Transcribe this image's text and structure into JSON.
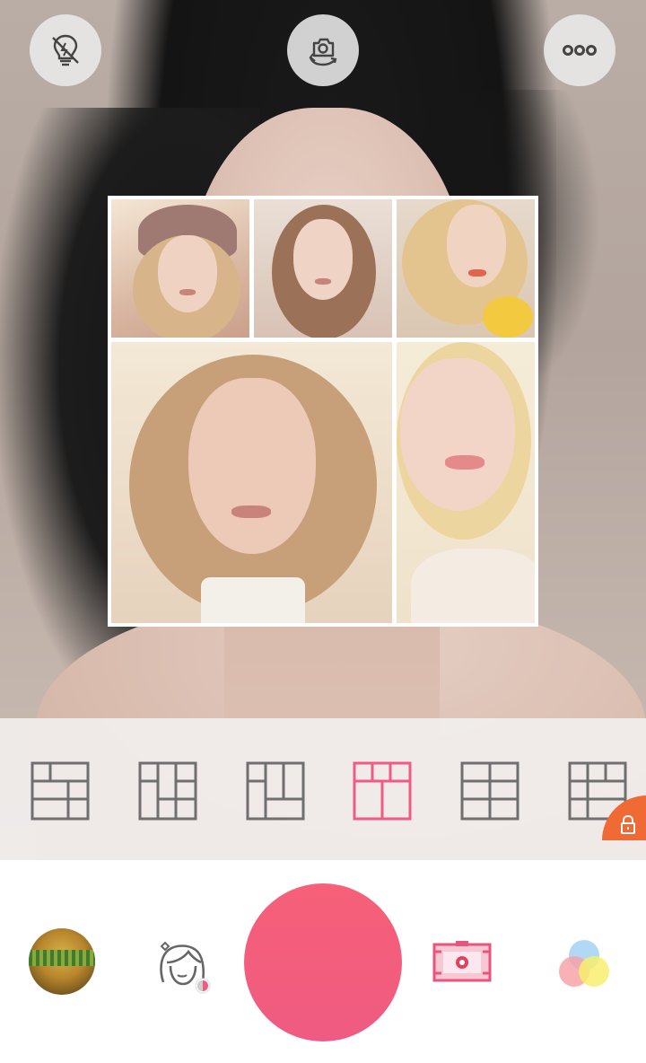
{
  "top_bar": {
    "flash_icon": "flash-off-bulb-icon",
    "switch_icon": "switch-camera-icon",
    "more_icon": "more-dots-icon"
  },
  "collage": {
    "frame_color": "#ffffff",
    "photo_count": 5
  },
  "layouts": {
    "items": [
      {
        "name": "layout-grid-1",
        "selected": false,
        "locked": false
      },
      {
        "name": "layout-grid-2",
        "selected": false,
        "locked": false
      },
      {
        "name": "layout-grid-3",
        "selected": false,
        "locked": false
      },
      {
        "name": "layout-grid-4",
        "selected": true,
        "locked": false
      },
      {
        "name": "layout-grid-5",
        "selected": false,
        "locked": false
      },
      {
        "name": "layout-grid-6",
        "selected": false,
        "locked": true
      }
    ],
    "icon_color": "#6f6f6f",
    "selected_color": "#ef5b82",
    "lock_color": "#ef6a34"
  },
  "bottom_bar": {
    "gallery_icon": "gallery-thumbnail",
    "beauty_icon": "beauty-face-icon",
    "shutter_color": "#f25f7d",
    "sticker_icon": "sticker-frame-icon",
    "filter_icon": "color-filter-icon"
  }
}
